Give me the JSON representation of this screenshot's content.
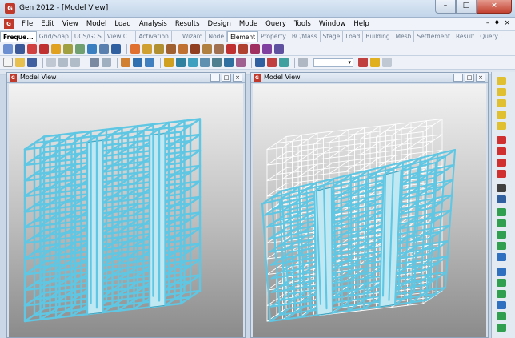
{
  "window": {
    "title": "Gen 2012 - [Model View]",
    "app_icon": "midas-logo-icon",
    "minimize": "–",
    "maximize": "□",
    "close": "×"
  },
  "menu": [
    {
      "label": "File"
    },
    {
      "label": "Edit"
    },
    {
      "label": "View"
    },
    {
      "label": "Model"
    },
    {
      "label": "Load"
    },
    {
      "label": "Analysis"
    },
    {
      "label": "Results"
    },
    {
      "label": "Design"
    },
    {
      "label": "Mode"
    },
    {
      "label": "Query"
    },
    {
      "label": "Tools"
    },
    {
      "label": "Window"
    },
    {
      "label": "Help"
    }
  ],
  "mdi_controls": {
    "min": "–",
    "restore": "♦",
    "close": "×"
  },
  "tabs_left": [
    "Freque...",
    "Grid/Snap",
    "UCS/GCS",
    "View C...",
    "Activation"
  ],
  "tabs_right": [
    "Wizard",
    "Node",
    "Element",
    "Property",
    "BC/Mass",
    "Stage",
    "Load",
    "Building",
    "Mesh",
    "Settlement",
    "Result",
    "Query"
  ],
  "active_tabs": [
    "Freque...",
    "Element"
  ],
  "views": {
    "left": {
      "title": "Model View"
    },
    "right": {
      "title": "Model View"
    }
  },
  "colors": {
    "frame": "#5fc7e3",
    "frame_dark": "#2f8fa8",
    "wall": "#bfe8f3",
    "undeformed": "#ffffff"
  }
}
